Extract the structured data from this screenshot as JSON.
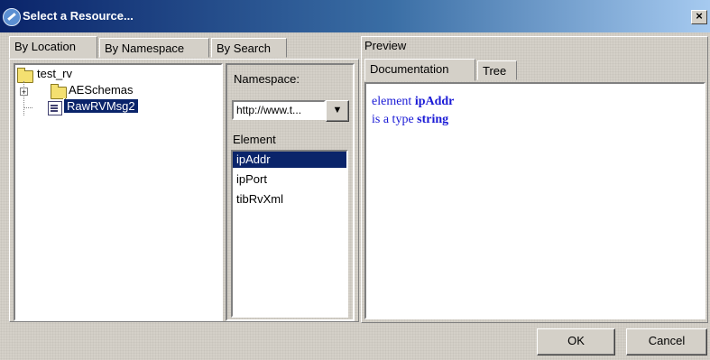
{
  "window": {
    "title": "Select a Resource...",
    "close_glyph": "×"
  },
  "left_tabs": [
    {
      "label": "By Location",
      "selected": true
    },
    {
      "label": "By Namespace",
      "selected": false
    },
    {
      "label": "By Search",
      "selected": false
    }
  ],
  "tree": {
    "root": {
      "label": "test_rv",
      "icon": "folder-open-icon"
    },
    "items": [
      {
        "label": "AESchemas",
        "icon": "folder-icon",
        "expander": "+"
      },
      {
        "label": "RawRVMsg2",
        "icon": "schema-icon",
        "selected": true
      }
    ]
  },
  "namespace": {
    "label": "Namespace:",
    "value": "http://www.t...",
    "arrow": "▼"
  },
  "element": {
    "label": "Element",
    "items": [
      {
        "label": "ipAddr",
        "selected": true
      },
      {
        "label": "ipPort",
        "selected": false
      },
      {
        "label": "tibRvXml",
        "selected": false
      }
    ]
  },
  "preview": {
    "label": "Preview",
    "tabs": [
      {
        "label": "Documentation",
        "selected": true
      },
      {
        "label": "Tree",
        "selected": false
      }
    ],
    "doc": {
      "line1_prefix": "element ",
      "line1_bold": "ipAddr",
      "line2_prefix": "is a type ",
      "line2_bold": "string"
    }
  },
  "buttons": {
    "ok": "OK",
    "cancel": "Cancel"
  },
  "colors": {
    "title_start": "#0a246a",
    "selection": "#0a246a",
    "doc_text": "#1a1ad6"
  }
}
